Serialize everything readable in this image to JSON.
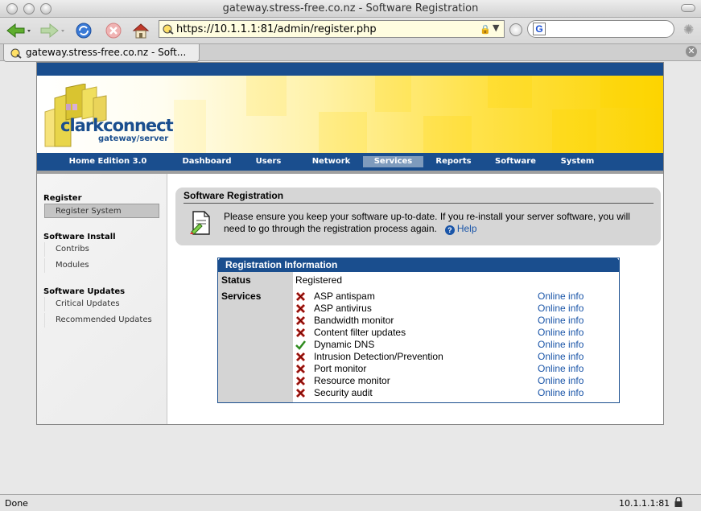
{
  "window": {
    "title": "gateway.stress-free.co.nz - Software Registration"
  },
  "toolbar": {
    "url": "https://10.1.1.1:81/admin/register.php",
    "search_value": ""
  },
  "tab": {
    "label": "gateway.stress-free.co.nz - Soft..."
  },
  "brand": {
    "logo_text": "clarkconnect",
    "logo_sub": "gateway/server",
    "accent": "#1a4e8e",
    "banner_yellow": "#fcd400"
  },
  "nav": {
    "edition": "Home Edition 3.0",
    "items": [
      "Dashboard",
      "Users",
      "Network",
      "Services",
      "Reports",
      "Software",
      "System"
    ],
    "active": "Services"
  },
  "sidebar": {
    "sections": [
      {
        "title": "Register",
        "items": [
          "Register System"
        ]
      },
      {
        "title": "Software Install",
        "items": [
          "Contribs",
          "Modules"
        ]
      },
      {
        "title": "Software Updates",
        "items": [
          "Critical Updates",
          "Recommended Updates"
        ]
      }
    ],
    "active_item": "Register System"
  },
  "info": {
    "title": "Software Registration",
    "text": "Please ensure you keep your software up-to-date. If you re-install your server software, you will need to go through the registration process again.",
    "help_label": "Help"
  },
  "registration": {
    "title": "Registration Information",
    "status_label": "Status",
    "status_value": "Registered",
    "services_label": "Services",
    "online_info_label": "Online info",
    "services": [
      {
        "name": "ASP antispam",
        "ok": false
      },
      {
        "name": "ASP antivirus",
        "ok": false
      },
      {
        "name": "Bandwidth monitor",
        "ok": false
      },
      {
        "name": "Content filter updates",
        "ok": false
      },
      {
        "name": "Dynamic DNS",
        "ok": true
      },
      {
        "name": "Intrusion Detection/Prevention",
        "ok": false
      },
      {
        "name": "Port monitor",
        "ok": false
      },
      {
        "name": "Resource monitor",
        "ok": false
      },
      {
        "name": "Security audit",
        "ok": false
      }
    ]
  },
  "statusbar": {
    "left": "Done",
    "right": "10.1.1.1:81"
  }
}
